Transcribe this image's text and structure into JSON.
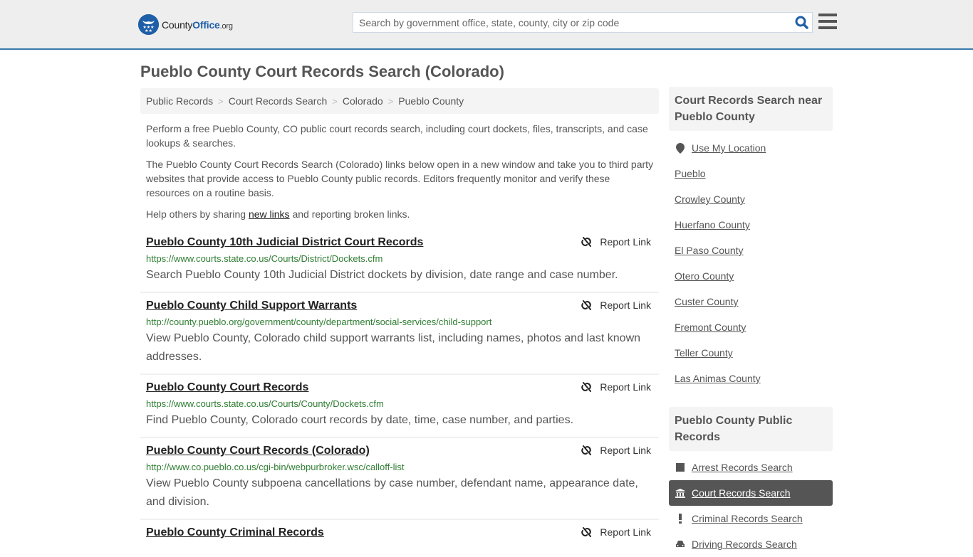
{
  "header": {
    "logo": {
      "county": "County",
      "office": "Office",
      "org": ".org",
      "badge_icon": "eagle-stars-icon"
    },
    "search": {
      "placeholder": "Search by government office, state, county, city or zip code",
      "value": ""
    },
    "search_icon": "search-icon",
    "menu_icon": "hamburger-menu-icon"
  },
  "page": {
    "title": "Pueblo County Court Records Search (Colorado)"
  },
  "breadcrumb": [
    {
      "label": "Public Records"
    },
    {
      "label": "Court Records Search"
    },
    {
      "label": "Colorado"
    },
    {
      "label": "Pueblo County"
    }
  ],
  "intro": {
    "p1": "Perform a free Pueblo County, CO public court records search, including court dockets, files, transcripts, and case lookups & searches.",
    "p2": "The Pueblo County Court Records Search (Colorado) links below open in a new window and take you to third party websites that provide access to Pueblo County public records. Editors frequently monitor and verify these resources on a routine basis.",
    "p3_before": "Help others by sharing ",
    "p3_link": "new links",
    "p3_after": " and reporting broken links."
  },
  "results": [
    {
      "title": "Pueblo County 10th Judicial District Court Records",
      "url": "https://www.courts.state.co.us/Courts/District/Dockets.cfm",
      "desc": "Search Pueblo County 10th Judicial District dockets by division, date range and case number.",
      "report": "Report Link"
    },
    {
      "title": "Pueblo County Child Support Warrants",
      "url": "http://county.pueblo.org/government/county/department/social-services/child-support",
      "desc": "View Pueblo County, Colorado child support warrants list, including names, photos and last known addresses.",
      "report": "Report Link"
    },
    {
      "title": "Pueblo County Court Records",
      "url": "https://www.courts.state.co.us/Courts/County/Dockets.cfm",
      "desc": "Find Pueblo County, Colorado court records by date, time, case number, and parties.",
      "report": "Report Link"
    },
    {
      "title": "Pueblo County Court Records (Colorado)",
      "url": "http://www.co.pueblo.co.us/cgi-bin/webpurbroker.wsc/calloff-list",
      "desc": "View Pueblo County subpoena cancellations by case number, defendant name, appearance date, and division.",
      "report": "Report Link"
    },
    {
      "title": "Pueblo County Criminal Records",
      "url": "",
      "desc": "",
      "report": "Report Link"
    }
  ],
  "sidebar_nearby": {
    "heading": "Court Records Search near Pueblo County",
    "use_location": "Use My Location",
    "items": [
      "Pueblo",
      "Crowley County",
      "Huerfano County",
      "El Paso County",
      "Otero County",
      "Custer County",
      "Fremont County",
      "Teller County",
      "Las Animas County"
    ]
  },
  "sidebar_public": {
    "heading": "Pueblo County Public Records",
    "items": [
      {
        "label": "Arrest Records Search",
        "icon": "square-icon",
        "active": false
      },
      {
        "label": "Court Records Search",
        "icon": "courthouse-icon",
        "active": true
      },
      {
        "label": "Criminal Records Search",
        "icon": "exclamation-icon",
        "active": false
      },
      {
        "label": "Driving Records Search",
        "icon": "car-icon",
        "active": false
      }
    ]
  },
  "colors": {
    "accent": "#1e5fa8",
    "header_border": "#3a7aab",
    "url_green": "#2f7d32",
    "active_bg": "#555555"
  }
}
